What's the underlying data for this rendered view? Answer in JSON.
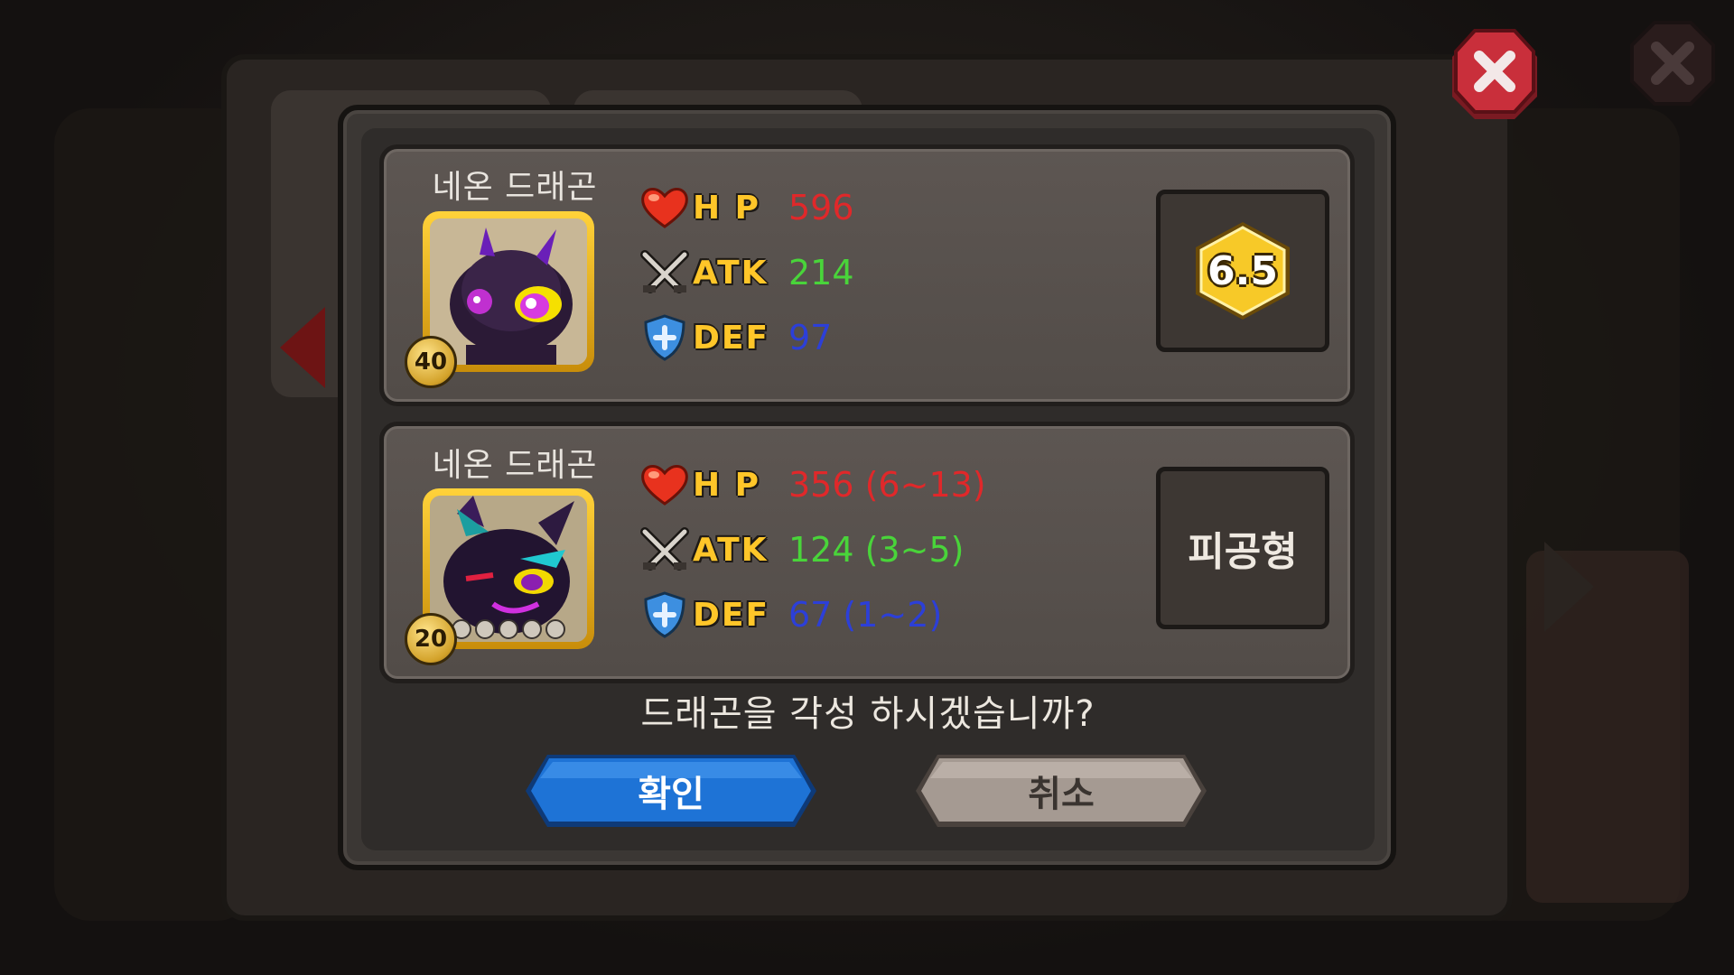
{
  "dialog": {
    "question": "드래곤을 각성 하시겠습니까?",
    "confirm_label": "확인",
    "cancel_label": "취소"
  },
  "current": {
    "name": "네온 드래곤",
    "level": "40",
    "hp": "596",
    "atk": "214",
    "def": "97",
    "grade": "6.5"
  },
  "awakened": {
    "name": "네온 드래곤",
    "level": "20",
    "hp": "356 (6~13)",
    "atk": "124 (3~5)",
    "def": "67 (1~2)",
    "type": "피공형"
  },
  "labels": {
    "hp": "H P",
    "atk": "ATK",
    "def": "DEF"
  },
  "colors": {
    "hp": "#e0282a",
    "atk": "#49d43a",
    "def": "#2c3fd8",
    "stat_label": "#ffc629",
    "confirm_button": "#1e73d6",
    "cancel_button": "#a59a92",
    "close_button": "#c02a35"
  },
  "icons": {
    "hp": "heart-icon",
    "atk": "crossed-swords-icon",
    "def": "shield-icon",
    "close": "close-icon"
  }
}
